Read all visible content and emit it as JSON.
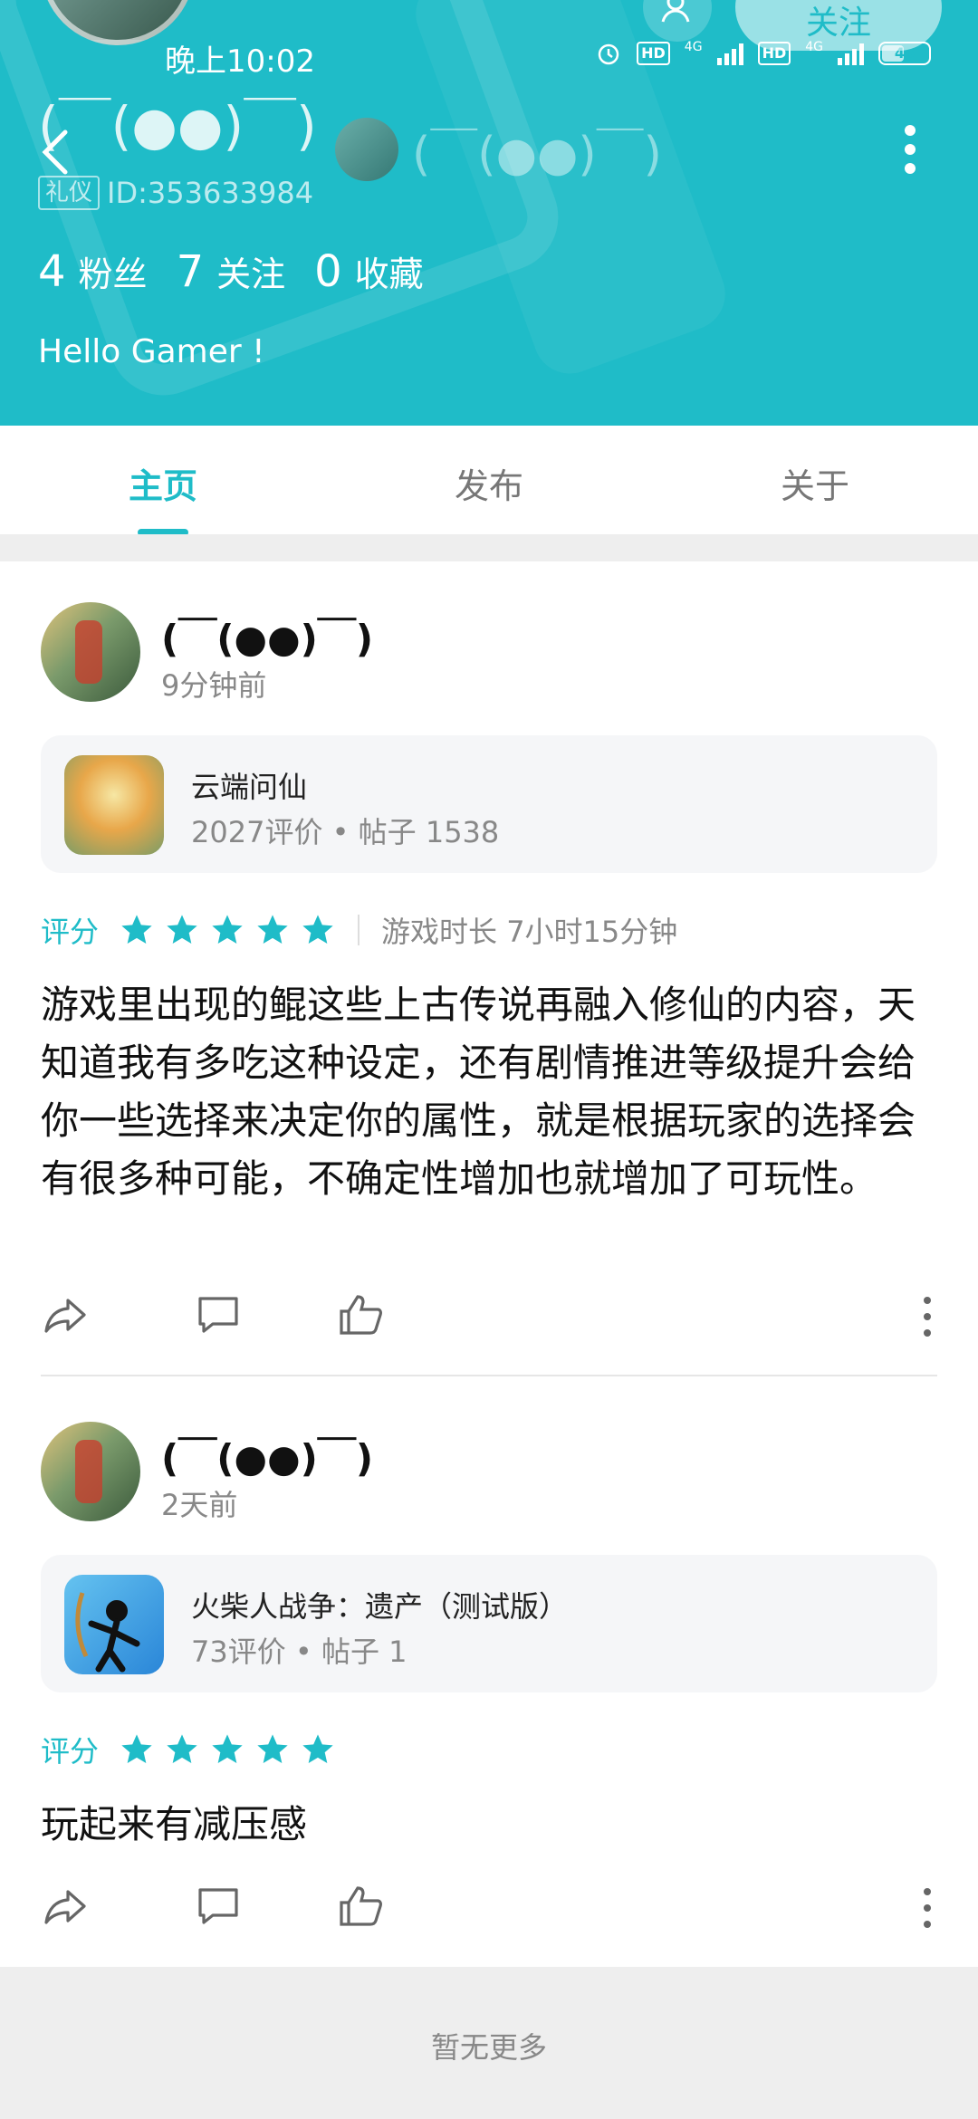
{
  "status_bar": {
    "time": "晚上10:02",
    "network_1": "4G",
    "network_2": "4G",
    "hd_1": "HD",
    "hd_2": "HD",
    "battery": "46"
  },
  "header": {
    "follow_label": "关注",
    "profile_name": "(￣(●●)￣)",
    "title_name": "(￣(●●)￣)",
    "badge": "礼仪",
    "user_id": "ID:353633984",
    "bio": "Hello Gamer !",
    "stats": [
      {
        "count": "4",
        "label": "粉丝"
      },
      {
        "count": "7",
        "label": "关注"
      },
      {
        "count": "0",
        "label": "收藏"
      }
    ],
    "accent_color": "#1fbcc8"
  },
  "tabs": [
    "主页",
    "发布",
    "关于"
  ],
  "posts": [
    {
      "author": "(￣(●●)￣)",
      "time": "9分钟前",
      "game": {
        "title": "云端问仙",
        "meta": "2027评价 • 帖子 1538"
      },
      "rating_label": "评分",
      "stars": 5,
      "duration": "游戏时长 7小时15分钟",
      "body": "游戏里出现的鲲这些上古传说再融入修仙的内容，天知道我有多吃这种设定，还有剧情推进等级提升会给你一些选择来决定你的属性，就是根据玩家的选择会有很多种可能，不确定性增加也就增加了可玩性。"
    },
    {
      "author": "(￣(●●)￣)",
      "time": "2天前",
      "game": {
        "title": "火柴人战争：遗产（测试版）",
        "meta": "73评价 • 帖子 1"
      },
      "rating_label": "评分",
      "stars": 5,
      "body": "玩起来有减压感"
    }
  ],
  "footer": {
    "text": "暂无更多"
  }
}
